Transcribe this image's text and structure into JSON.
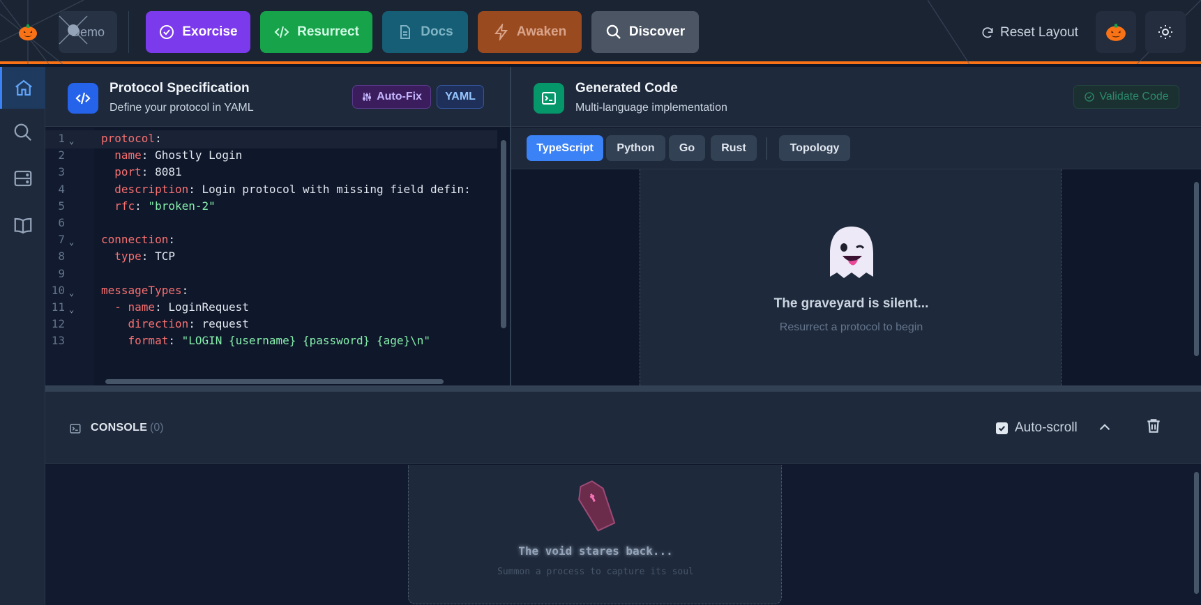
{
  "topbar": {
    "demo_label": "Demo",
    "buttons": [
      {
        "label": "Exorcise",
        "icon": "check-circle-icon"
      },
      {
        "label": "Resurrect",
        "icon": "code-icon"
      },
      {
        "label": "Docs",
        "icon": "document-icon"
      },
      {
        "label": "Awaken",
        "icon": "lightning-icon"
      },
      {
        "label": "Discover",
        "icon": "search-icon"
      }
    ],
    "reset_layout_label": "Reset Layout",
    "accent_color": "#f97316"
  },
  "sidebar": {
    "items": [
      {
        "icon": "home-icon",
        "active": true
      },
      {
        "icon": "search-icon",
        "active": false
      },
      {
        "icon": "server-icon",
        "active": false
      },
      {
        "icon": "book-icon",
        "active": false
      }
    ]
  },
  "spec_panel": {
    "title": "Protocol Specification",
    "subtitle": "Define your protocol in YAML",
    "autofix_label": "Auto-Fix",
    "format_label": "YAML",
    "line_numbers": [
      "1",
      "2",
      "3",
      "4",
      "5",
      "6",
      "7",
      "8",
      "9",
      "10",
      "11",
      "12",
      "13"
    ],
    "code_lines": [
      {
        "key": "protocol",
        "sep": ":",
        "val": ""
      },
      {
        "key": "  name",
        "sep": ": ",
        "val": "Ghostly Login"
      },
      {
        "key": "  port",
        "sep": ": ",
        "val": "8081"
      },
      {
        "key": "  description",
        "sep": ": ",
        "val": "Login protocol with missing field defin:"
      },
      {
        "key": "  rfc",
        "sep": ": ",
        "val": "\"broken-2\""
      },
      {
        "key": "",
        "sep": "",
        "val": ""
      },
      {
        "key": "connection",
        "sep": ":",
        "val": ""
      },
      {
        "key": "  type",
        "sep": ": ",
        "val": "TCP"
      },
      {
        "key": "",
        "sep": "",
        "val": ""
      },
      {
        "key": "messageTypes",
        "sep": ":",
        "val": ""
      },
      {
        "key": "  - name",
        "sep": ": ",
        "val": "LoginRequest"
      },
      {
        "key": "    direction",
        "sep": ": ",
        "val": "request"
      },
      {
        "key": "    format",
        "sep": ": ",
        "val": "\"LOGIN {username} {password} {age}\\n\""
      }
    ]
  },
  "generated_panel": {
    "title": "Generated Code",
    "subtitle": "Multi-language implementation",
    "validate_label": "Validate Code",
    "tabs": [
      "TypeScript",
      "Python",
      "Go",
      "Rust"
    ],
    "active_tab": "TypeScript",
    "topology_label": "Topology",
    "empty_title": "The graveyard is silent...",
    "empty_subtitle": "Resurrect a protocol to begin"
  },
  "console": {
    "title": "CONSOLE",
    "count": "(0)",
    "auto_scroll_label": "Auto-scroll",
    "auto_scroll_checked": true,
    "empty_title": "The void stares back...",
    "empty_subtitle": "Summon a process to capture its soul"
  }
}
